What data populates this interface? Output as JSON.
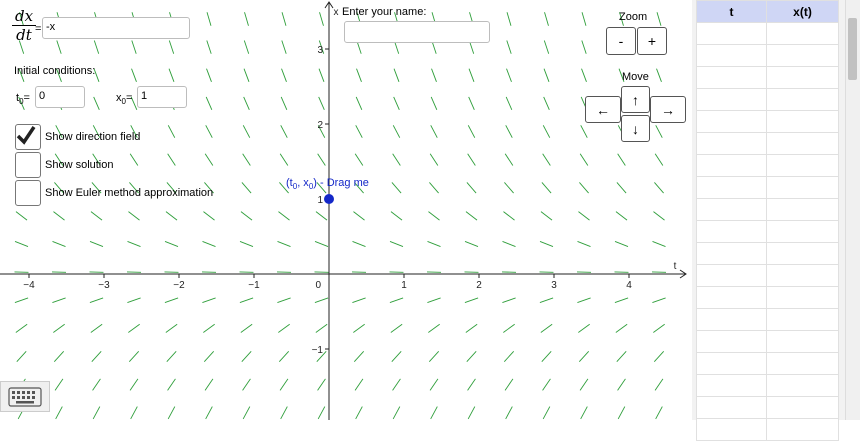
{
  "equation": {
    "numerator": "dx",
    "denominator": "dt",
    "equals": "=",
    "value": "-x"
  },
  "initial_conditions": {
    "label": "Initial conditions:",
    "t0_symbol": "t",
    "t0_sub": "0",
    "t0_value": "0",
    "x0_symbol": "x",
    "x0_sub": "0",
    "x0_value": "1",
    "equals": "="
  },
  "checkboxes": [
    {
      "label": "Show direction field",
      "checked": true
    },
    {
      "label": "Show solution",
      "checked": false
    },
    {
      "label": "Show Euler method approximation",
      "checked": false
    }
  ],
  "name_field": {
    "label": "Enter your name:",
    "value": ""
  },
  "point": {
    "caption_open": "(t",
    "sub1": "0",
    "comma": ", x",
    "sub2": "0",
    "caption_close": ") - Drag me",
    "t": 0,
    "x": 1,
    "color": "#1428c8"
  },
  "axes": {
    "x_label": "t",
    "y_label": "x",
    "x_ticks": [
      "−4",
      "−3",
      "−2",
      "−1",
      "1",
      "2",
      "3",
      "4"
    ],
    "y_ticks": [
      "3",
      "2",
      "1",
      "−1"
    ],
    "origin": "0",
    "t_range": [
      -4.4,
      4.7
    ],
    "x_range": [
      -1.9,
      3.6
    ]
  },
  "slope_field_color": "#2e9e3a",
  "zoom": {
    "title": "Zoom",
    "minus": "-",
    "plus": "+"
  },
  "move": {
    "title": "Move",
    "up": "↑",
    "down": "↓",
    "left": "←",
    "right": "→"
  },
  "keyboard_icon": "keyboard-icon",
  "table": {
    "headers": [
      "t",
      "x(t)"
    ],
    "rows": 19
  }
}
